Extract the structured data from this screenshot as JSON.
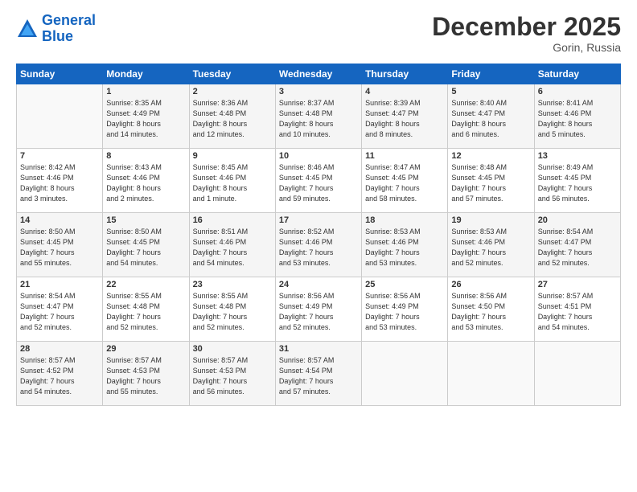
{
  "header": {
    "logo_line1": "General",
    "logo_line2": "Blue",
    "month": "December 2025",
    "location": "Gorin, Russia"
  },
  "weekdays": [
    "Sunday",
    "Monday",
    "Tuesday",
    "Wednesday",
    "Thursday",
    "Friday",
    "Saturday"
  ],
  "weeks": [
    [
      {
        "day": "",
        "content": ""
      },
      {
        "day": "1",
        "content": "Sunrise: 8:35 AM\nSunset: 4:49 PM\nDaylight: 8 hours\nand 14 minutes."
      },
      {
        "day": "2",
        "content": "Sunrise: 8:36 AM\nSunset: 4:48 PM\nDaylight: 8 hours\nand 12 minutes."
      },
      {
        "day": "3",
        "content": "Sunrise: 8:37 AM\nSunset: 4:48 PM\nDaylight: 8 hours\nand 10 minutes."
      },
      {
        "day": "4",
        "content": "Sunrise: 8:39 AM\nSunset: 4:47 PM\nDaylight: 8 hours\nand 8 minutes."
      },
      {
        "day": "5",
        "content": "Sunrise: 8:40 AM\nSunset: 4:47 PM\nDaylight: 8 hours\nand 6 minutes."
      },
      {
        "day": "6",
        "content": "Sunrise: 8:41 AM\nSunset: 4:46 PM\nDaylight: 8 hours\nand 5 minutes."
      }
    ],
    [
      {
        "day": "7",
        "content": "Sunrise: 8:42 AM\nSunset: 4:46 PM\nDaylight: 8 hours\nand 3 minutes."
      },
      {
        "day": "8",
        "content": "Sunrise: 8:43 AM\nSunset: 4:46 PM\nDaylight: 8 hours\nand 2 minutes."
      },
      {
        "day": "9",
        "content": "Sunrise: 8:45 AM\nSunset: 4:46 PM\nDaylight: 8 hours\nand 1 minute."
      },
      {
        "day": "10",
        "content": "Sunrise: 8:46 AM\nSunset: 4:45 PM\nDaylight: 7 hours\nand 59 minutes."
      },
      {
        "day": "11",
        "content": "Sunrise: 8:47 AM\nSunset: 4:45 PM\nDaylight: 7 hours\nand 58 minutes."
      },
      {
        "day": "12",
        "content": "Sunrise: 8:48 AM\nSunset: 4:45 PM\nDaylight: 7 hours\nand 57 minutes."
      },
      {
        "day": "13",
        "content": "Sunrise: 8:49 AM\nSunset: 4:45 PM\nDaylight: 7 hours\nand 56 minutes."
      }
    ],
    [
      {
        "day": "14",
        "content": "Sunrise: 8:50 AM\nSunset: 4:45 PM\nDaylight: 7 hours\nand 55 minutes."
      },
      {
        "day": "15",
        "content": "Sunrise: 8:50 AM\nSunset: 4:45 PM\nDaylight: 7 hours\nand 54 minutes."
      },
      {
        "day": "16",
        "content": "Sunrise: 8:51 AM\nSunset: 4:46 PM\nDaylight: 7 hours\nand 54 minutes."
      },
      {
        "day": "17",
        "content": "Sunrise: 8:52 AM\nSunset: 4:46 PM\nDaylight: 7 hours\nand 53 minutes."
      },
      {
        "day": "18",
        "content": "Sunrise: 8:53 AM\nSunset: 4:46 PM\nDaylight: 7 hours\nand 53 minutes."
      },
      {
        "day": "19",
        "content": "Sunrise: 8:53 AM\nSunset: 4:46 PM\nDaylight: 7 hours\nand 52 minutes."
      },
      {
        "day": "20",
        "content": "Sunrise: 8:54 AM\nSunset: 4:47 PM\nDaylight: 7 hours\nand 52 minutes."
      }
    ],
    [
      {
        "day": "21",
        "content": "Sunrise: 8:54 AM\nSunset: 4:47 PM\nDaylight: 7 hours\nand 52 minutes."
      },
      {
        "day": "22",
        "content": "Sunrise: 8:55 AM\nSunset: 4:48 PM\nDaylight: 7 hours\nand 52 minutes."
      },
      {
        "day": "23",
        "content": "Sunrise: 8:55 AM\nSunset: 4:48 PM\nDaylight: 7 hours\nand 52 minutes."
      },
      {
        "day": "24",
        "content": "Sunrise: 8:56 AM\nSunset: 4:49 PM\nDaylight: 7 hours\nand 52 minutes."
      },
      {
        "day": "25",
        "content": "Sunrise: 8:56 AM\nSunset: 4:49 PM\nDaylight: 7 hours\nand 53 minutes."
      },
      {
        "day": "26",
        "content": "Sunrise: 8:56 AM\nSunset: 4:50 PM\nDaylight: 7 hours\nand 53 minutes."
      },
      {
        "day": "27",
        "content": "Sunrise: 8:57 AM\nSunset: 4:51 PM\nDaylight: 7 hours\nand 54 minutes."
      }
    ],
    [
      {
        "day": "28",
        "content": "Sunrise: 8:57 AM\nSunset: 4:52 PM\nDaylight: 7 hours\nand 54 minutes."
      },
      {
        "day": "29",
        "content": "Sunrise: 8:57 AM\nSunset: 4:53 PM\nDaylight: 7 hours\nand 55 minutes."
      },
      {
        "day": "30",
        "content": "Sunrise: 8:57 AM\nSunset: 4:53 PM\nDaylight: 7 hours\nand 56 minutes."
      },
      {
        "day": "31",
        "content": "Sunrise: 8:57 AM\nSunset: 4:54 PM\nDaylight: 7 hours\nand 57 minutes."
      },
      {
        "day": "",
        "content": ""
      },
      {
        "day": "",
        "content": ""
      },
      {
        "day": "",
        "content": ""
      }
    ]
  ]
}
